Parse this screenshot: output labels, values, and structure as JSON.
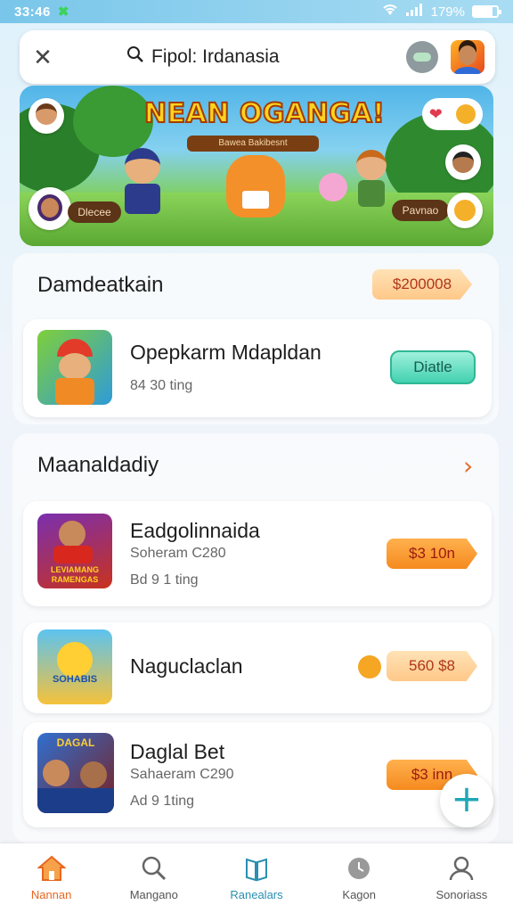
{
  "status": {
    "time": "33:46",
    "battery": "179%"
  },
  "search": {
    "query": "Fipol: Irdanasia"
  },
  "banner": {
    "title": "NEAN OGANGA!",
    "plaque": "Bawea Bakibesnt",
    "left_pill": "Dlecee",
    "right_pill": "Pavnao"
  },
  "section1": {
    "title": "Damdeatkain",
    "badge": "$200008",
    "item": {
      "name": "Opepkarm Mdapldan",
      "meta": "84 30 ting",
      "button": "Diatle"
    }
  },
  "section2": {
    "title": "Maanaldadiy",
    "items": [
      {
        "name": "Eadgolinnaida",
        "sub": "Soheram C280",
        "meta": "Bd 9 1 ting",
        "price": "$3 10n",
        "thumb_text": "LEVIAMANG RAMENGAS"
      },
      {
        "name": "Naguclaclan",
        "sub": "",
        "meta": "",
        "price": "560 $8",
        "thumb_text": "SOHABIS"
      },
      {
        "name": "Daglal Bet",
        "sub": "Sahaeram C290",
        "meta": "Ad 9 1ting",
        "price": "$3 inn",
        "thumb_text": "DAGAL"
      }
    ]
  },
  "nav": [
    {
      "label": "Nannan"
    },
    {
      "label": "Mangano"
    },
    {
      "label": "Ranealars"
    },
    {
      "label": "Kagon"
    },
    {
      "label": "Sonoriass"
    }
  ]
}
